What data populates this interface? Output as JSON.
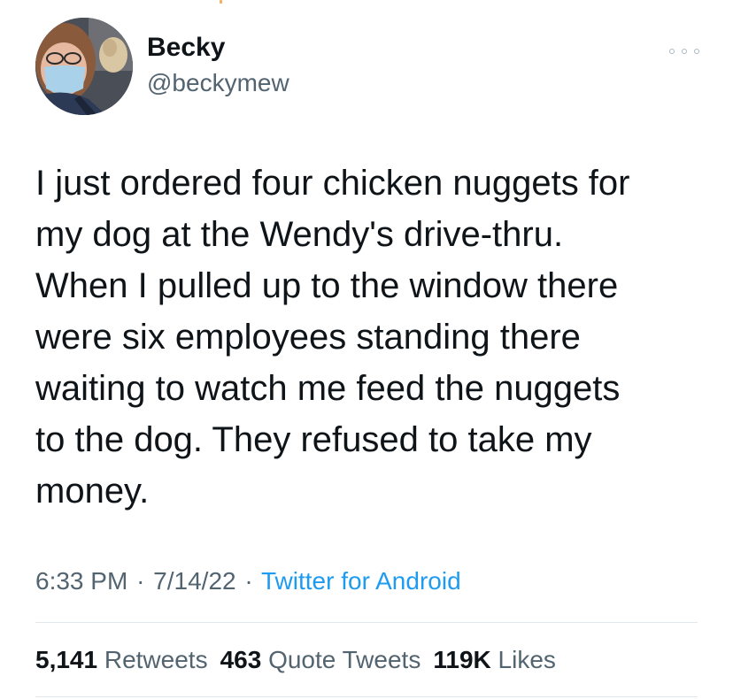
{
  "author": {
    "display_name": "Becky",
    "handle": "@beckymew"
  },
  "tweet": {
    "text": "I just ordered four chicken nuggets for\nmy dog at the Wendy's drive-thru.\nWhen I pulled up to the window there\nwere six employees standing there\nwaiting to watch me feed the nuggets\nto the dog. They refused to take my\nmoney.",
    "time": "6:33 PM",
    "date": "7/14/22",
    "source": "Twitter for Android",
    "separator": "·"
  },
  "stats": {
    "retweets_count": "5,141",
    "retweets_label": "Retweets",
    "quotes_count": "463",
    "quotes_label": "Quote Tweets",
    "likes_count": "119K",
    "likes_label": "Likes"
  },
  "icons": {
    "more": "more-horizontal-icon"
  },
  "colors": {
    "text_primary": "#0f1419",
    "text_secondary": "#536471",
    "link": "#1d9bf0",
    "divider": "#e1e8ed"
  }
}
